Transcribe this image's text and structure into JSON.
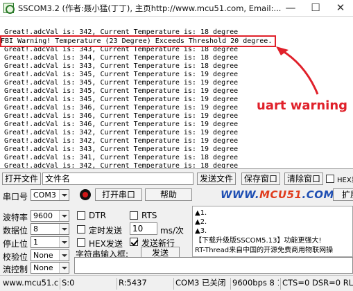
{
  "window": {
    "title": "SSCOM3.2 (作者:聂小猛(丁丁), 主页http://www.mcu51.com,  Email:...",
    "minimize_glyph": "—",
    "maximize_glyph": "☐",
    "close_glyph": "✕"
  },
  "terminal": {
    "lines": [
      "Great!.adcVal is: 342, Current Temperature is: 18 degree",
      "FBI Warning! Temperature (23 Degree) Exceeds Threshold 20 degree.",
      "Great!.adcVal is: 343, Current Temperature is: 18 degree",
      "Great!.adcVal is: 344, Current Temperature is: 18 degree",
      "Great!.adcVal is: 343, Current Temperature is: 18 degree",
      "Great!.adcVal is: 345, Current Temperature is: 19 degree",
      "Great!.adcVal is: 345, Current Temperature is: 19 degree",
      "Great!.adcVal is: 345, Current Temperature is: 19 degree",
      "Great!.adcVal is: 345, Current Temperature is: 19 degree",
      "Great!.adcVal is: 346, Current Temperature is: 19 degree",
      "Great!.adcVal is: 346, Current Temperature is: 19 degree",
      "Great!.adcVal is: 346, Current Temperature is: 19 degree",
      "Great!.adcVal is: 342, Current Temperature is: 19 degree",
      "Great!.adcVal is: 342, Current Temperature is: 19 degree",
      "Great!.adcVal is: 343, Current Temperature is: 19 degree",
      "Great!.adcVal is: 341, Current Temperature is: 18 degree",
      "Great!.adcVal is: 342, Current Temperature is: 18 degree"
    ],
    "annotation": "uart warning",
    "annotation_color": "#e0202a"
  },
  "file_row": {
    "open_file_label": "打开文件",
    "filename_value": "文件名",
    "send_file_label": "发送文件",
    "save_window_label": "保存窗口",
    "clear_window_label": "清除窗口",
    "hex_display_label": "HEX显"
  },
  "port_row": {
    "port_label": "串口号",
    "port_value": "COM3",
    "open_port_label": "打开串口",
    "help_label": "帮助",
    "brand_www": "WWW.",
    "brand_mcu": "MCU51",
    "brand_com": ".COM",
    "expand_label": "扩展"
  },
  "settings": {
    "baud_label": "波特率",
    "baud_value": "9600",
    "databits_label": "数据位",
    "databits_value": "8",
    "stopbits_label": "停止位",
    "stopbits_value": "1",
    "parity_label": "校验位",
    "parity_value": "None",
    "flow_label": "流控制",
    "flow_value": "None"
  },
  "options": {
    "dtr_label": "DTR",
    "rts_label": "RTS",
    "timed_send_label": "定时发送",
    "interval_value": "10",
    "interval_unit": "ms/次",
    "hex_send_label": "HEX发送",
    "send_newline_label": "发送新行",
    "send_newline_checked": true,
    "input_label": "字符串输入框:",
    "send_label": "发送"
  },
  "info_panel": {
    "lines": [
      "▲1.",
      "▲2.",
      "▲3.",
      "【下载升级版SSCOM5.13】功能更强大!",
      "RT-Thread来自中国的开源免费商用物联网操"
    ]
  },
  "statusbar": {
    "site": "www.mcu51.com",
    "s_count": "S:0",
    "r_count": "R:5437",
    "port_status": "COM3 已关闭",
    "baud_info": "9600bps 8 1",
    "lines_status": "CTS=0 DSR=0 RLSD"
  }
}
